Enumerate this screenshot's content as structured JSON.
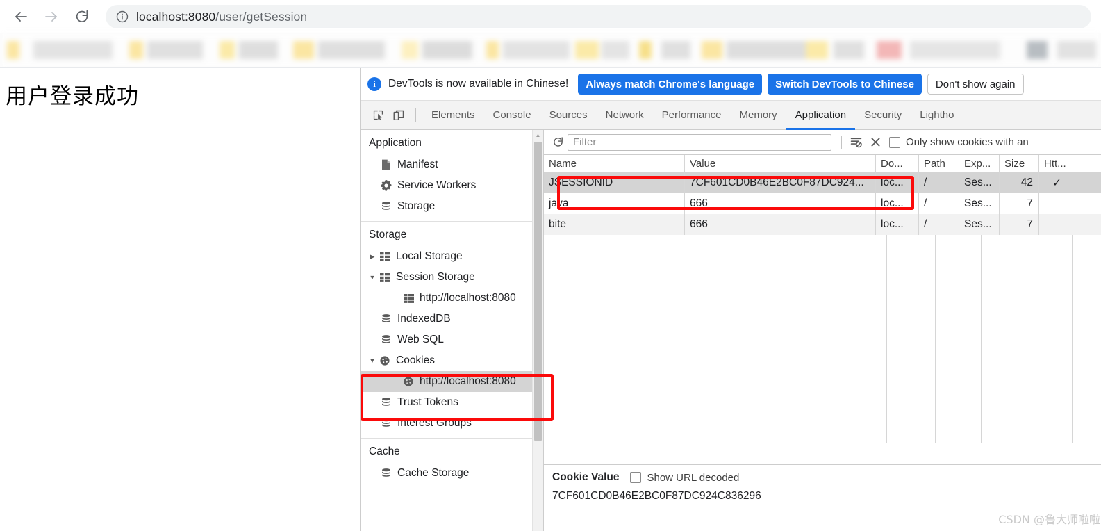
{
  "browser": {
    "back_label": "Back",
    "forward_label": "Forward",
    "reload_label": "Reload",
    "site_info_label": "View site information",
    "url_host": "localhost:8080",
    "url_path": "/user/getSession"
  },
  "page": {
    "heading": "用户登录成功"
  },
  "devtools": {
    "banner": {
      "message": "DevTools is now available in Chinese!",
      "primary_1": "Always match Chrome's language",
      "primary_2": "Switch DevTools to Chinese",
      "secondary": "Don't show again",
      "accent_color": "#1a73e8"
    },
    "toolbar_icons": [
      {
        "name": "inspect-element-icon",
        "label": "Inspect element"
      },
      {
        "name": "device-toolbar-icon",
        "label": "Toggle device toolbar"
      }
    ],
    "tabs": [
      {
        "label": "Elements",
        "active": false
      },
      {
        "label": "Console",
        "active": false
      },
      {
        "label": "Sources",
        "active": false
      },
      {
        "label": "Network",
        "active": false
      },
      {
        "label": "Performance",
        "active": false
      },
      {
        "label": "Memory",
        "active": false
      },
      {
        "label": "Application",
        "active": true
      },
      {
        "label": "Security",
        "active": false
      },
      {
        "label": "Lightho",
        "active": false
      }
    ],
    "sidebar": {
      "sections": [
        {
          "title": "Application",
          "items": [
            {
              "label": "Manifest",
              "icon": "manifest-file-icon",
              "indent": 1,
              "arrow": "",
              "selected": false
            },
            {
              "label": "Service Workers",
              "icon": "gear-icon",
              "indent": 1,
              "arrow": "",
              "selected": false
            },
            {
              "label": "Storage",
              "icon": "database-icon",
              "indent": 1,
              "arrow": "",
              "selected": false
            }
          ]
        },
        {
          "title": "Storage",
          "items": [
            {
              "label": "Local Storage",
              "icon": "table-grid-icon",
              "indent": 0,
              "arrow": "collapsed",
              "selected": false
            },
            {
              "label": "Session Storage",
              "icon": "table-grid-icon",
              "indent": 0,
              "arrow": "expanded",
              "selected": false
            },
            {
              "label": "http://localhost:8080",
              "icon": "table-grid-icon",
              "indent": 2,
              "arrow": "",
              "selected": false
            },
            {
              "label": "IndexedDB",
              "icon": "database-icon",
              "indent": 1,
              "arrow": "",
              "selected": false
            },
            {
              "label": "Web SQL",
              "icon": "database-icon",
              "indent": 1,
              "arrow": "",
              "selected": false
            },
            {
              "label": "Cookies",
              "icon": "cookie-icon",
              "indent": 0,
              "arrow": "expanded",
              "selected": false
            },
            {
              "label": "http://localhost:8080",
              "icon": "cookie-icon",
              "indent": 2,
              "arrow": "",
              "selected": true
            },
            {
              "label": "Trust Tokens",
              "icon": "database-icon",
              "indent": 1,
              "arrow": "",
              "selected": false
            },
            {
              "label": "Interest Groups",
              "icon": "database-icon",
              "indent": 1,
              "arrow": "",
              "selected": false
            }
          ]
        },
        {
          "title": "Cache",
          "items": [
            {
              "label": "Cache Storage",
              "icon": "database-icon",
              "indent": 1,
              "arrow": "",
              "selected": false
            }
          ]
        }
      ]
    },
    "filter_bar": {
      "refresh_label": "Refresh",
      "filter_placeholder": "Filter",
      "filter_value": "",
      "clear_filtered_label": "Clear filtered cookies",
      "clear_all_label": "Clear all cookies",
      "only_show_label": "Only show cookies with an",
      "only_show_checked": false
    },
    "cookie_table": {
      "columns": [
        "Name",
        "Value",
        "Do...",
        "Path",
        "Exp...",
        "Size",
        "Htt..."
      ],
      "rows": [
        {
          "name": "JSESSIONID",
          "value": "7CF601CD0B46E2BC0F87DC924...",
          "domain": "loc...",
          "path": "/",
          "expires": "Ses...",
          "size": "42",
          "httponly": "✓",
          "selected": true
        },
        {
          "name": "java",
          "value": "666",
          "domain": "loc...",
          "path": "/",
          "expires": "Ses...",
          "size": "7",
          "httponly": "",
          "selected": false
        },
        {
          "name": "bite",
          "value": "666",
          "domain": "loc...",
          "path": "/",
          "expires": "Ses...",
          "size": "7",
          "httponly": "",
          "selected": false
        }
      ]
    },
    "cookie_value_panel": {
      "title": "Cookie Value",
      "show_url_decoded_label": "Show URL decoded",
      "show_url_decoded_checked": false,
      "value": "7CF601CD0B46E2BC0F87DC924C836296"
    }
  },
  "watermark": "CSDN @鲁大师啦啦啦",
  "annotations": {
    "color": "#fb0a0a",
    "boxes": [
      "cookies-tree-highlight",
      "jsessionid-row-highlight"
    ]
  }
}
